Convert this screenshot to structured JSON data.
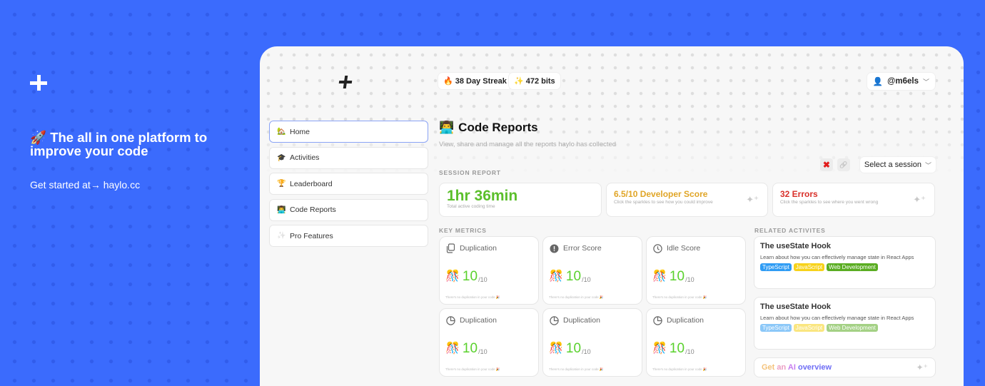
{
  "promo": {
    "headline_emoji": "🚀",
    "headline": "The all in one platform to improve your code",
    "cta": "Get started at→ haylo.cc"
  },
  "topbar": {
    "streak": {
      "emoji": "🔥",
      "label": "38 Day Streak"
    },
    "bits": {
      "emoji": "✨",
      "label": "472 bits"
    },
    "user": {
      "emoji": "👤",
      "handle": "@m6els"
    }
  },
  "sidebar": {
    "items": [
      {
        "emoji": "🏡",
        "label": "Home",
        "active": true
      },
      {
        "emoji": "🎓",
        "label": "Activities",
        "active": false
      },
      {
        "emoji": "🏆",
        "label": "Leaderboard",
        "active": false
      },
      {
        "emoji": "👨‍💻",
        "label": "Code Reports",
        "active": false
      },
      {
        "emoji": "✨",
        "label": "Pro Features",
        "active": false
      }
    ]
  },
  "page": {
    "title_emoji": "👨‍💻",
    "title": "Code Reports",
    "subtitle": "View, share and manage all the reports haylo has collected"
  },
  "session": {
    "label": "SESSION REPORT",
    "select_placeholder": "Select a session",
    "delete_icon": "✖",
    "link_icon": "🔗",
    "time": {
      "value": "1hr 36min",
      "caption": "Total active coding time"
    },
    "score": {
      "value": "6.5/10 Developer Score",
      "caption": "Click the sparkles to see how you could improve",
      "color": "#e0a526"
    },
    "errors": {
      "value": "32 Errors",
      "caption": "Click the sparkles to see where you went wrong",
      "color": "#d9302a"
    }
  },
  "metrics": {
    "label": "KEY METRICS",
    "items": [
      {
        "icon": "copy",
        "title": "Duplication",
        "value": "10",
        "max": "/10",
        "note": "There's no duplication in your code 🎉"
      },
      {
        "icon": "alert",
        "title": "Error Score",
        "value": "10",
        "max": "/10",
        "note": "There's no duplication in your code 🎉"
      },
      {
        "icon": "clock",
        "title": "Idle Score",
        "value": "10",
        "max": "/10",
        "note": "There's no duplication in your code 🎉"
      },
      {
        "icon": "pie",
        "title": "Duplication",
        "value": "10",
        "max": "/10",
        "note": "There's no duplication in your code 🎉"
      },
      {
        "icon": "pie",
        "title": "Duplication",
        "value": "10",
        "max": "/10",
        "note": "There's no duplication in your code 🎉"
      },
      {
        "icon": "pie",
        "title": "Duplication",
        "value": "10",
        "max": "/10",
        "note": "There's no duplication in your code 🎉"
      }
    ],
    "gift_emoji": "🎊"
  },
  "related": {
    "label": "RELATED ACTIVITES",
    "items": [
      {
        "title": "The useState Hook",
        "description": "Learn about how you can effectively manage state in React Apps",
        "tags": [
          {
            "label": "TypeScript",
            "color": "#2f9cf4"
          },
          {
            "label": "JavaScript",
            "color": "#f7d21a"
          },
          {
            "label": "Web Development",
            "color": "#5aad22"
          }
        ]
      },
      {
        "title": "The useState Hook",
        "description": "Learn about how you can effectively manage state in React Apps",
        "tags": [
          {
            "label": "TypeScript",
            "color": "#2f9cf4"
          },
          {
            "label": "JavaScript",
            "color": "#f7d21a"
          },
          {
            "label": "Web Development",
            "color": "#5aad22"
          }
        ]
      }
    ],
    "ai_overview": {
      "words": [
        "Get",
        "an",
        "AI",
        "overview"
      ],
      "colors": [
        "#f4c27a",
        "#ec9fc4",
        "#c77ef0",
        "#6f6ef5"
      ]
    }
  },
  "colors": {
    "accent": "#3b6bfd",
    "success": "#5ad12d"
  }
}
